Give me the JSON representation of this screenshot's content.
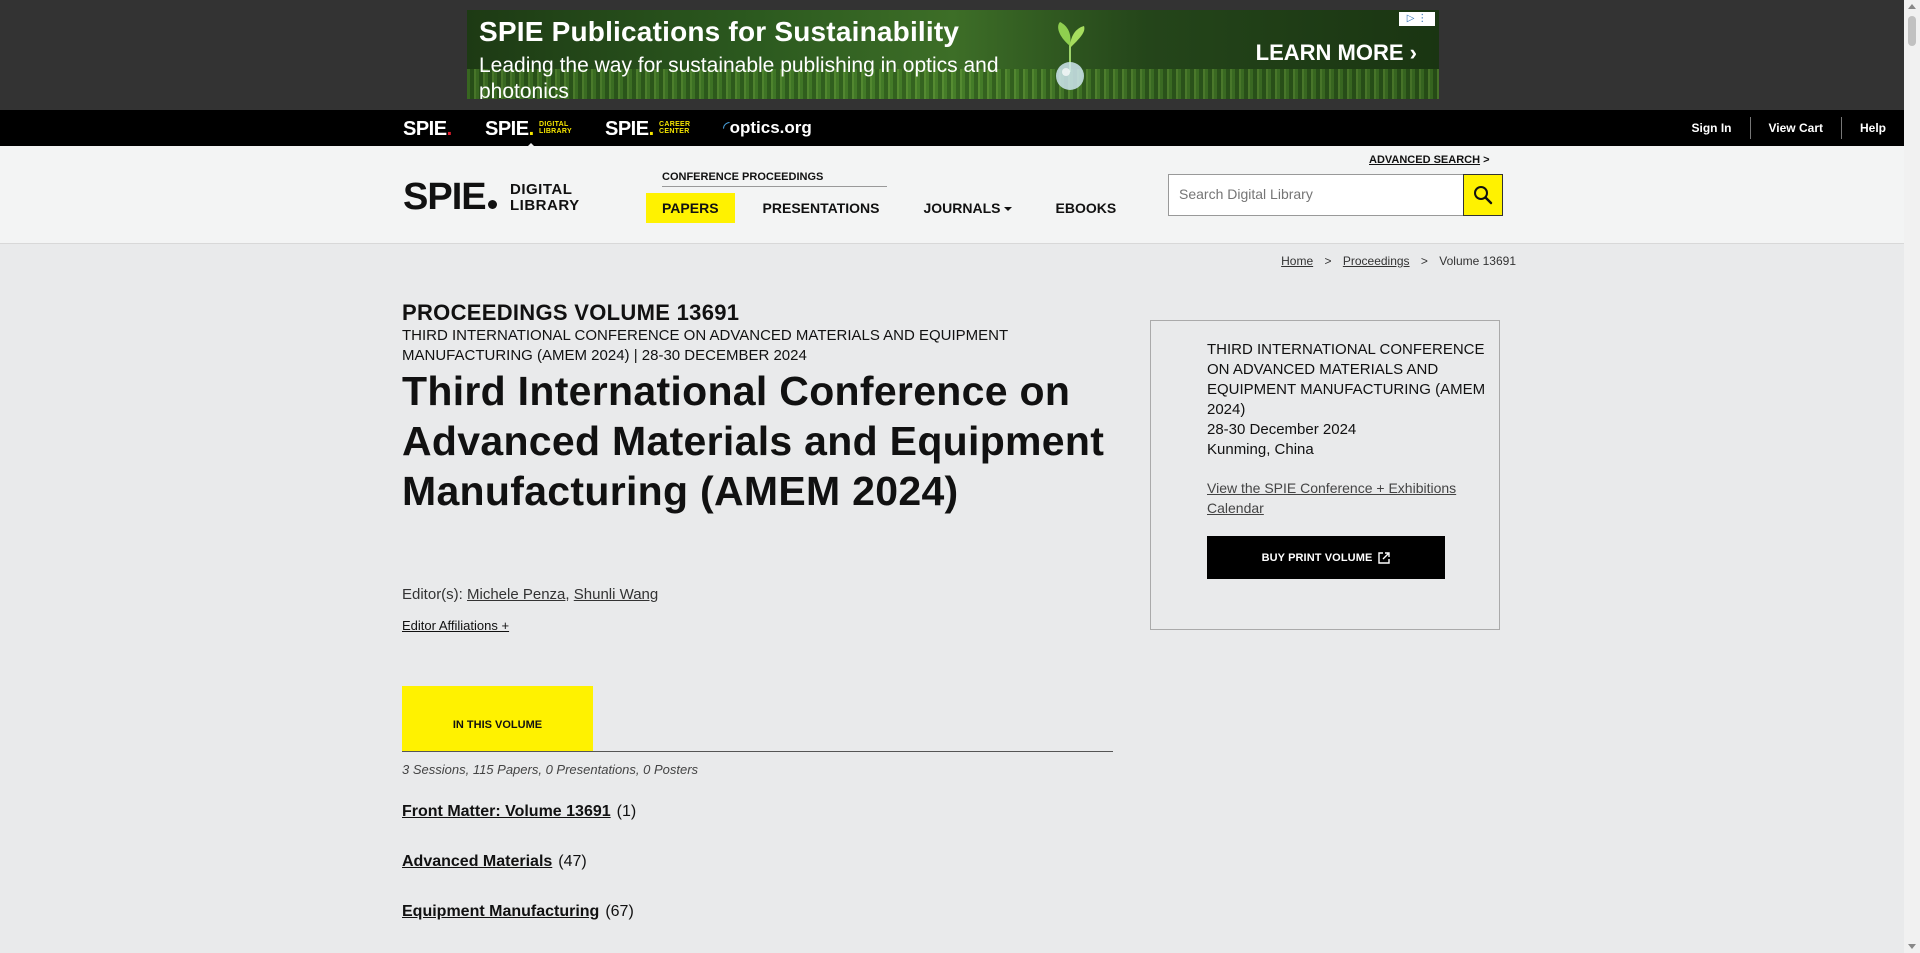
{
  "ad": {
    "headline": "SPIE Publications for Sustainability",
    "subline": "Leading the way for sustainable publishing in optics and photonics",
    "cta": "LEARN MORE ›"
  },
  "topnav": {
    "brands": [
      {
        "name": "SPIE",
        "sub": ""
      },
      {
        "name": "SPIE",
        "sub": "DIGITAL LIBRARY"
      },
      {
        "name": "SPIE",
        "sub": "CAREER CENTER"
      },
      {
        "name": "optics.org",
        "sub": ""
      }
    ],
    "links": [
      "Sign In",
      "View Cart",
      "Help"
    ]
  },
  "header": {
    "logo_main": "SPIE",
    "logo_sub_1": "DIGITAL",
    "logo_sub_2": "LIBRARY",
    "section_label": "CONFERENCE PROCEEDINGS",
    "nav": [
      "PAPERS",
      "PRESENTATIONS",
      "JOURNALS",
      "EBOOKS"
    ],
    "advanced_search": "ADVANCED SEARCH",
    "advanced_search_arrow": ">",
    "search_placeholder": "Search Digital Library"
  },
  "breadcrumb": {
    "items": [
      "Home",
      "Proceedings",
      "Volume 13691"
    ],
    "separator": ">"
  },
  "volume": {
    "label": "PROCEEDINGS VOLUME 13691",
    "meta": "THIRD INTERNATIONAL CONFERENCE ON ADVANCED MATERIALS AND EQUIPMENT MANUFACTURING (AMEM 2024) | 28-30 DECEMBER 2024",
    "title": "Third International Conference on Advanced Materials and Equipment Manufacturing (AMEM 2024)",
    "editors_label": "Editor(s):",
    "editors": [
      "Michele Penza",
      "Shunli Wang"
    ],
    "affiliations_link": "Editor Affiliations +"
  },
  "tabs": {
    "in_this_volume": "IN THIS VOLUME",
    "counts": "3 Sessions, 115 Papers, 0 Presentations, 0 Posters"
  },
  "sessions": [
    {
      "title": "Front Matter: Volume 13691",
      "count": "(1)"
    },
    {
      "title": "Advanced Materials",
      "count": "(47)"
    },
    {
      "title": "Equipment Manufacturing",
      "count": "(67)"
    }
  ],
  "sidebar": {
    "conference": "THIRD INTERNATIONAL CONFERENCE ON ADVANCED MATERIALS AND EQUIPMENT MANUFACTURING (AMEM 2024)",
    "dates": "28-30 December 2024",
    "location": "Kunming, China",
    "calendar_link": "View the SPIE Conference + Exhibitions Calendar",
    "buy_button": "BUY PRINT VOLUME"
  },
  "colors": {
    "accent_yellow": "#fff200",
    "topbar": "#000000",
    "ad_strip": "#333333",
    "page_bg": "#e9eaeb"
  }
}
